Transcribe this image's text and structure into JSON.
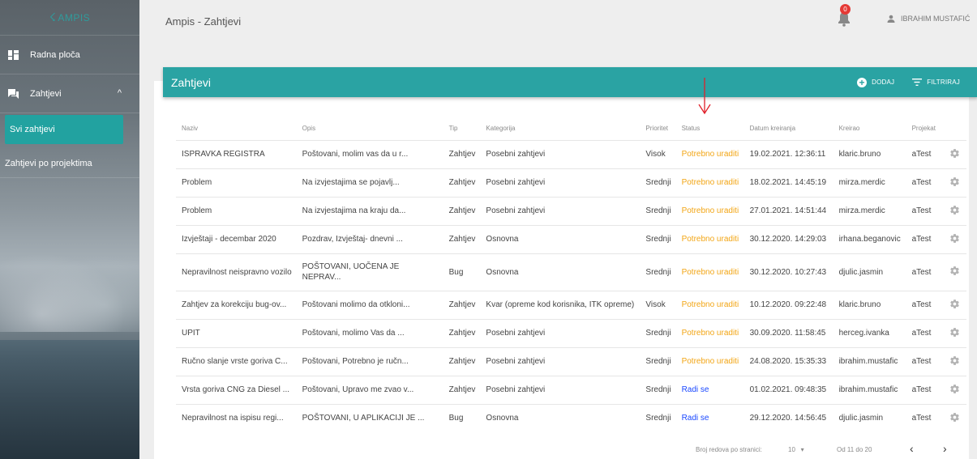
{
  "sidebar": {
    "logo": "AMPIS",
    "items": [
      {
        "label": "Radna ploča",
        "icon": "dashboard-icon"
      },
      {
        "label": "Zahtjevi",
        "icon": "forum-icon",
        "expanded": true
      }
    ],
    "sub_items": [
      {
        "label": "Svi zahtjevi",
        "active": true
      },
      {
        "label": "Zahtjevi po projektima",
        "active": false
      }
    ]
  },
  "topbar": {
    "title": "Ampis - Zahtjevi",
    "notification_count": "0",
    "user_name": "IBRAHIM MUSTAFIĆ"
  },
  "card": {
    "title": "Zahtjevi",
    "add_label": "DODAJ",
    "filter_label": "FILTRIRAJ"
  },
  "table": {
    "columns": [
      "Naziv",
      "Opis",
      "Tip",
      "Kategorija",
      "Prioritet",
      "Status",
      "Datum kreiranja",
      "Kreirao",
      "Projekat"
    ],
    "rows": [
      {
        "naziv": "ISPRAVKA REGISTRA",
        "opis": "Poštovani, molim vas da u r...",
        "tip": "Zahtjev",
        "kategorija": "Posebni zahtjevi",
        "prioritet": "Visok",
        "status": "Potrebno uraditi",
        "datum": "19.02.2021. 12:36:11",
        "kreirao": "klaric.bruno",
        "projekat": "aTest"
      },
      {
        "naziv": "Problem",
        "opis": "Na izvjestajima se pojavlj...",
        "tip": "Zahtjev",
        "kategorija": "Posebni zahtjevi",
        "prioritet": "Srednji",
        "status": "Potrebno uraditi",
        "datum": "18.02.2021. 14:45:19",
        "kreirao": "mirza.merdic",
        "projekat": "aTest"
      },
      {
        "naziv": "Problem",
        "opis": "Na izvjestajima na kraju da...",
        "tip": "Zahtjev",
        "kategorija": "Posebni zahtjevi",
        "prioritet": "Srednji",
        "status": "Potrebno uraditi",
        "datum": "27.01.2021. 14:51:44",
        "kreirao": "mirza.merdic",
        "projekat": "aTest"
      },
      {
        "naziv": "Izvještaji - decembar 2020",
        "opis": "Pozdrav, Izvještaj- dnevni ...",
        "tip": "Zahtjev",
        "kategorija": "Osnovna",
        "prioritet": "Srednji",
        "status": "Potrebno uraditi",
        "datum": "30.12.2020. 14:29:03",
        "kreirao": "irhana.beganovic",
        "projekat": "aTest"
      },
      {
        "naziv": "Nepravilnost neispravno vozilo",
        "opis": "POŠTOVANI, UOČENA JE NEPRAV...",
        "tip": "Bug",
        "kategorija": "Osnovna",
        "prioritet": "Srednji",
        "status": "Potrebno uraditi",
        "datum": "30.12.2020. 10:27:43",
        "kreirao": "djulic.jasmin",
        "projekat": "aTest"
      },
      {
        "naziv": "Zahtjev za korekciju bug-ov...",
        "opis": "Poštovani molimo da otkloni...",
        "tip": "Zahtjev",
        "kategorija": "Kvar (opreme kod korisnika, ITK opreme)",
        "prioritet": "Visok",
        "status": "Potrebno uraditi",
        "datum": "10.12.2020. 09:22:48",
        "kreirao": "klaric.bruno",
        "projekat": "aTest"
      },
      {
        "naziv": "UPIT",
        "opis": "Poštovani, molimo Vas da ...",
        "tip": "Zahtjev",
        "kategorija": "Posebni zahtjevi",
        "prioritet": "Srednji",
        "status": "Potrebno uraditi",
        "datum": "30.09.2020. 11:58:45",
        "kreirao": "herceg.ivanka",
        "projekat": "aTest"
      },
      {
        "naziv": "Ručno slanje vrste goriva C...",
        "opis": "Poštovani, Potrebno je ručn...",
        "tip": "Zahtjev",
        "kategorija": "Posebni zahtjevi",
        "prioritet": "Srednji",
        "status": "Potrebno uraditi",
        "datum": "24.08.2020. 15:35:33",
        "kreirao": "ibrahim.mustafic",
        "projekat": "aTest"
      },
      {
        "naziv": "Vrsta goriva CNG za Diesel ...",
        "opis": "Poštovani, Upravo me zvao v...",
        "tip": "Zahtjev",
        "kategorija": "Posebni zahtjevi",
        "prioritet": "Srednji",
        "status": "Radi se",
        "datum": "01.02.2021. 09:48:35",
        "kreirao": "ibrahim.mustafic",
        "projekat": "aTest"
      },
      {
        "naziv": "Nepravilnost na ispisu regi...",
        "opis": "POŠTOVANI, U APLIKACIJI JE ...",
        "tip": "Bug",
        "kategorija": "Osnovna",
        "prioritet": "Srednji",
        "status": "Radi se",
        "datum": "29.12.2020. 14:56:45",
        "kreirao": "djulic.jasmin",
        "projekat": "aTest"
      }
    ]
  },
  "pagination": {
    "rows_per_page_label": "Broj redova po stranici:",
    "rows_per_page_value": "10",
    "range": "Od 11 do 20",
    "prev": "‹",
    "next": "›"
  },
  "colors": {
    "teal": "#2aa3a3",
    "status_todo": "#f2a514",
    "status_in_progress": "#1a48ff",
    "badge": "#e53935"
  }
}
